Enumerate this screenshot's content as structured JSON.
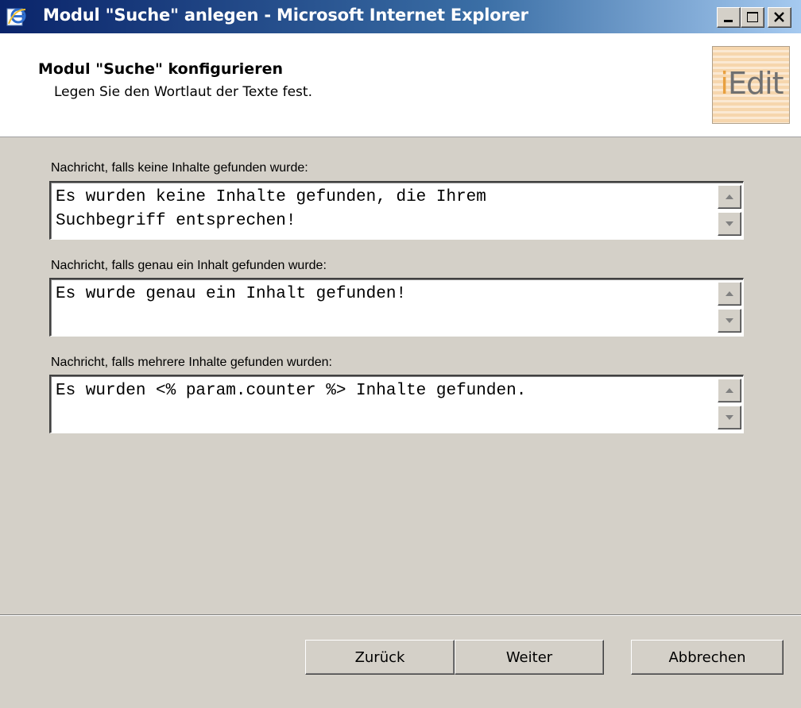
{
  "window": {
    "title": "Modul \"Suche\" anlegen - Microsoft Internet Explorer",
    "icon": "ie-icon",
    "controls": [
      "minimize-icon",
      "maximize-icon",
      "close-icon"
    ]
  },
  "header": {
    "title": "Modul \"Suche\" konfigurieren",
    "subtitle": "Legen Sie den Wortlaut der Texte fest.",
    "logo_prefix": "i",
    "logo_rest": "Edit"
  },
  "fields": [
    {
      "label": "Nachricht, falls keine Inhalte gefunden wurde:",
      "value": "Es wurden keine Inhalte gefunden, die Ihrem\nSuchbegriff entsprechen!"
    },
    {
      "label": "Nachricht, falls genau ein Inhalt gefunden wurde:",
      "value": "Es wurde genau ein Inhalt gefunden!"
    },
    {
      "label": "Nachricht, falls mehrere Inhalte gefunden wurden:",
      "value": "Es wurden <% param.counter %> Inhalte gefunden."
    }
  ],
  "buttons": {
    "back": "Zurück",
    "next": "Weiter",
    "cancel": "Abbrechen"
  },
  "colors": {
    "titlebar_start": "#0a246a",
    "titlebar_end": "#a6caf0",
    "dialog_bg": "#d4d0c8",
    "logo_accent": "#e8a040"
  }
}
